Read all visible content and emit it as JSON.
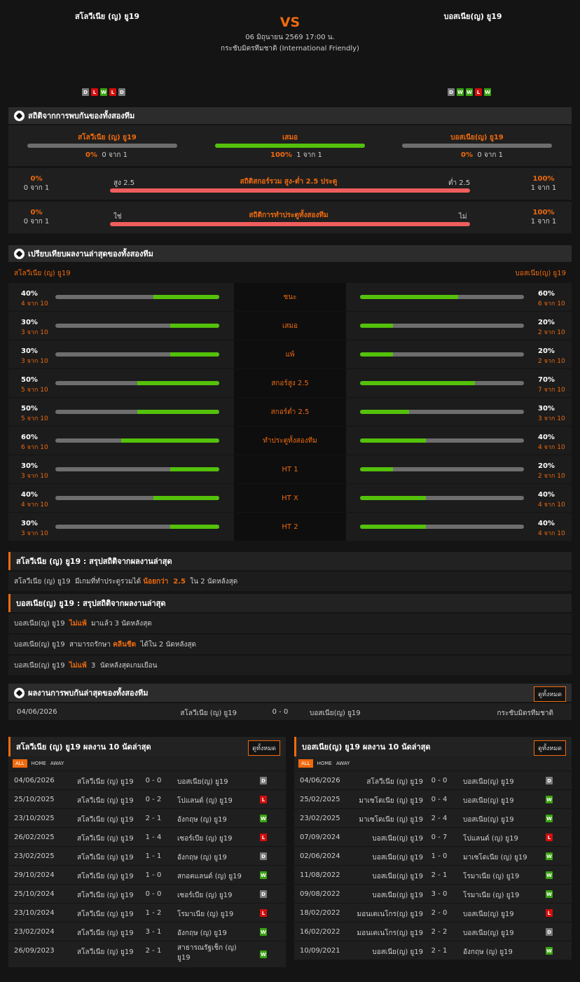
{
  "header": {
    "home_team": "สโลวีเนีย (ญ) ยู19",
    "away_team": "บอสเนีย(ญ) ยู19",
    "vs": "VS",
    "date": "06 มิถุนายน 2569 17:00 น.",
    "competition": "กระชับมิตรทีมชาติ (International Friendly)",
    "home_form": [
      "D",
      "L",
      "W",
      "L",
      "D"
    ],
    "away_form": [
      "D",
      "W",
      "W",
      "L",
      "W"
    ]
  },
  "h2h": {
    "title": "สถิติจากการพบกันของทั้งสองทีม",
    "home": {
      "label": "สโลวีเนีย (ญ) ยู19",
      "pct": "0%",
      "sub": "0 จาก 1",
      "value": 0
    },
    "draw": {
      "label": "เสมอ",
      "pct": "100%",
      "sub": "1 จาก 1",
      "value": 100
    },
    "away": {
      "label": "บอสเนีย(ญ) ยู19",
      "pct": "0%",
      "sub": "0 จาก 1",
      "value": 0
    },
    "ou": {
      "title": "สถิติสกอร์รวม สูง-ต่ำ 2.5 ประตู",
      "left": "สูง 2.5",
      "right": "ต่ำ 2.5",
      "lpct": "0%",
      "lsub": "0 จาก 1",
      "rpct": "100%",
      "rsub": "1 จาก 1",
      "value": 0
    },
    "btts": {
      "title": "สถิติการทำประตูทั้งสองทีม",
      "left": "ใช่",
      "right": "ไม่",
      "lpct": "0%",
      "lsub": "0 จาก 1",
      "rpct": "100%",
      "rsub": "1 จาก 1",
      "value": 0
    }
  },
  "compare": {
    "title": "เปรียบเทียบผลงานล่าสุดของทั้งสองทีม",
    "home": "สโลวีเนีย (ญ) ยู19",
    "away": "บอสเนีย(ญ) ยู19",
    "rows": [
      {
        "label": "ชนะ",
        "hp": "40%",
        "hs": "4 จาก 10",
        "hv": 40,
        "ap": "60%",
        "as": "6 จาก 10",
        "av": 60
      },
      {
        "label": "เสมอ",
        "hp": "30%",
        "hs": "3 จาก 10",
        "hv": 30,
        "ap": "20%",
        "as": "2 จาก 10",
        "av": 20
      },
      {
        "label": "แพ้",
        "hp": "30%",
        "hs": "3 จาก 10",
        "hv": 30,
        "ap": "20%",
        "as": "2 จาก 10",
        "av": 20
      },
      {
        "label": "สกอร์สูง 2.5",
        "hp": "50%",
        "hs": "5 จาก 10",
        "hv": 50,
        "ap": "70%",
        "as": "7 จาก 10",
        "av": 70
      },
      {
        "label": "สกอร์ต่ำ 2.5",
        "hp": "50%",
        "hs": "5 จาก 10",
        "hv": 50,
        "ap": "30%",
        "as": "3 จาก 10",
        "av": 30
      },
      {
        "label": "ทำประตูทั้งสองทีม",
        "hp": "60%",
        "hs": "6 จาก 10",
        "hv": 60,
        "ap": "40%",
        "as": "4 จาก 10",
        "av": 40
      },
      {
        "label": "HT 1",
        "hp": "30%",
        "hs": "3 จาก 10",
        "hv": 30,
        "ap": "20%",
        "as": "2 จาก 10",
        "av": 20
      },
      {
        "label": "HT X",
        "hp": "40%",
        "hs": "4 จาก 10",
        "hv": 40,
        "ap": "40%",
        "as": "4 จาก 10",
        "av": 40
      },
      {
        "label": "HT 2",
        "hp": "30%",
        "hs": "3 จาก 10",
        "hv": 30,
        "ap": "40%",
        "as": "4 จาก 10",
        "av": 40
      }
    ]
  },
  "summary_home": {
    "title": "สโลวีเนีย (ญ) ยู19 : สรุปสถิติจากผลงานล่าสุด",
    "rows": [
      {
        "a": "สโลวีเนีย (ญ) ยู19  มีเกมที่ทำประตูรวมได้ ",
        "b": "น้อยกว่า  2.5",
        "c": "  ใน 2 นัดหลังสุด"
      }
    ]
  },
  "summary_away": {
    "title": "บอสเนีย(ญ) ยู19 : สรุปสถิติจากผลงานล่าสุด",
    "rows": [
      {
        "a": "บอสเนีย(ญ) ยู19  ",
        "b": "ไม่แพ้",
        "c": "  มาแล้ว 3 นัดหลังสุด"
      },
      {
        "a": "บอสเนีย(ญ) ยู19  สามารถรักษา ",
        "b": "คลีนชีต",
        "c": "  ได้ใน 2 นัดหลังสุด"
      },
      {
        "a": "บอสเนีย(ญ) ยู19  ",
        "b": "ไม่แพ้",
        "c": "  3  นัดหลังสุดเกมเยือน"
      }
    ]
  },
  "recent_h2h": {
    "title": "ผลงานการพบกันล่าสุดของทั้งสองทีม",
    "view_all": "ดูทั้งหมด",
    "rows": [
      {
        "date": "04/06/2026",
        "home": "สโลวีเนีย (ญ) ยู19",
        "score": "0 - 0",
        "away": "บอสเนีย(ญ) ยู19",
        "comp": "กระชับมิตรทีมชาติ"
      }
    ]
  },
  "tabs": {
    "all": "ALL",
    "home": "HOME",
    "away": "AWAY"
  },
  "last_home": {
    "title": "สโลวีเนีย (ญ) ยู19 ผลงาน 10 นัดล่าสุด",
    "view_all": "ดูทั้งหมด",
    "rows": [
      {
        "date": "04/06/2026",
        "home": "สโลวีเนีย (ญ) ยู19",
        "score": "0 - 0",
        "away": "บอสเนีย(ญ) ยู19",
        "res": "D"
      },
      {
        "date": "25/10/2025",
        "home": "สโลวีเนีย (ญ) ยู19",
        "score": "0 - 2",
        "away": "โปแลนด์ (ญ) ยู19",
        "res": "L"
      },
      {
        "date": "23/10/2025",
        "home": "สโลวีเนีย (ญ) ยู19",
        "score": "2 - 1",
        "away": "อังกฤษ (ญ) ยู19",
        "res": "W"
      },
      {
        "date": "26/02/2025",
        "home": "สโลวีเนีย (ญ) ยู19",
        "score": "1 - 4",
        "away": "เซอร์เบีย (ญ) ยู19",
        "res": "L"
      },
      {
        "date": "23/02/2025",
        "home": "สโลวีเนีย (ญ) ยู19",
        "score": "1 - 1",
        "away": "อังกฤษ (ญ) ยู19",
        "res": "D"
      },
      {
        "date": "29/10/2024",
        "home": "สโลวีเนีย (ญ) ยู19",
        "score": "1 - 0",
        "away": "สกอตแลนด์ (ญ) ยู19",
        "res": "W"
      },
      {
        "date": "25/10/2024",
        "home": "สโลวีเนีย (ญ) ยู19",
        "score": "0 - 0",
        "away": "เซอร์เบีย (ญ) ยู19",
        "res": "D"
      },
      {
        "date": "23/10/2024",
        "home": "สโลวีเนีย (ญ) ยู19",
        "score": "1 - 2",
        "away": "โรมาเนีย (ญ) ยู19",
        "res": "L"
      },
      {
        "date": "23/02/2024",
        "home": "สโลวีเนีย (ญ) ยู19",
        "score": "3 - 1",
        "away": "อังกฤษ (ญ) ยู19",
        "res": "W"
      },
      {
        "date": "26/09/2023",
        "home": "สโลวีเนีย (ญ) ยู19",
        "score": "2 - 1",
        "away": "สาธารณรัฐเช็ก (ญ)",
        "away2": "ยู19",
        "res": "W"
      }
    ]
  },
  "last_away": {
    "title": "บอสเนีย(ญ) ยู19 ผลงาน 10 นัดล่าสุด",
    "view_all": "ดูทั้งหมด",
    "rows": [
      {
        "date": "04/06/2026",
        "home": "สโลวีเนีย (ญ) ยู19",
        "score": "0 - 0",
        "away": "บอสเนีย(ญ) ยู19",
        "res": "D"
      },
      {
        "date": "25/02/2025",
        "home": "มาเซโดเนีย (ญ) ยู19",
        "score": "0 - 4",
        "away": "บอสเนีย(ญ) ยู19",
        "res": "W"
      },
      {
        "date": "23/02/2025",
        "home": "มาเซโดเนีย (ญ) ยู19",
        "score": "2 - 4",
        "away": "บอสเนีย(ญ) ยู19",
        "res": "W"
      },
      {
        "date": "07/09/2024",
        "home": "บอสเนีย(ญ) ยู19",
        "score": "0 - 7",
        "away": "โปแลนด์ (ญ) ยู19",
        "res": "L"
      },
      {
        "date": "02/06/2024",
        "home": "บอสเนีย(ญ) ยู19",
        "score": "1 - 0",
        "away": "มาเซโดเนีย (ญ) ยู19",
        "res": "W"
      },
      {
        "date": "11/08/2022",
        "home": "บอสเนีย(ญ) ยู19",
        "score": "2 - 1",
        "away": "โรมาเนีย (ญ) ยู19",
        "res": "W"
      },
      {
        "date": "09/08/2022",
        "home": "บอสเนีย(ญ) ยู19",
        "score": "3 - 0",
        "away": "โรมาเนีย (ญ) ยู19",
        "res": "W"
      },
      {
        "date": "18/02/2022",
        "home": "มอนเตเนโกร(ญ) ยู19",
        "score": "2 - 0",
        "away": "บอสเนีย(ญ) ยู19",
        "res": "L"
      },
      {
        "date": "16/02/2022",
        "home": "มอนเตเนโกร(ญ) ยู19",
        "score": "2 - 2",
        "away": "บอสเนีย(ญ) ยู19",
        "res": "D"
      },
      {
        "date": "10/09/2021",
        "home": "บอสเนีย(ญ) ยู19",
        "score": "2 - 1",
        "away": "อังกฤษ (ญ) ยู19",
        "res": "W"
      }
    ]
  },
  "colors": {
    "accent": "#f06a0e",
    "green": "#54c10b",
    "red": "#f05d5d",
    "win": "#3aa312",
    "loss": "#d40d0d",
    "draw": "#7a7a7a"
  }
}
